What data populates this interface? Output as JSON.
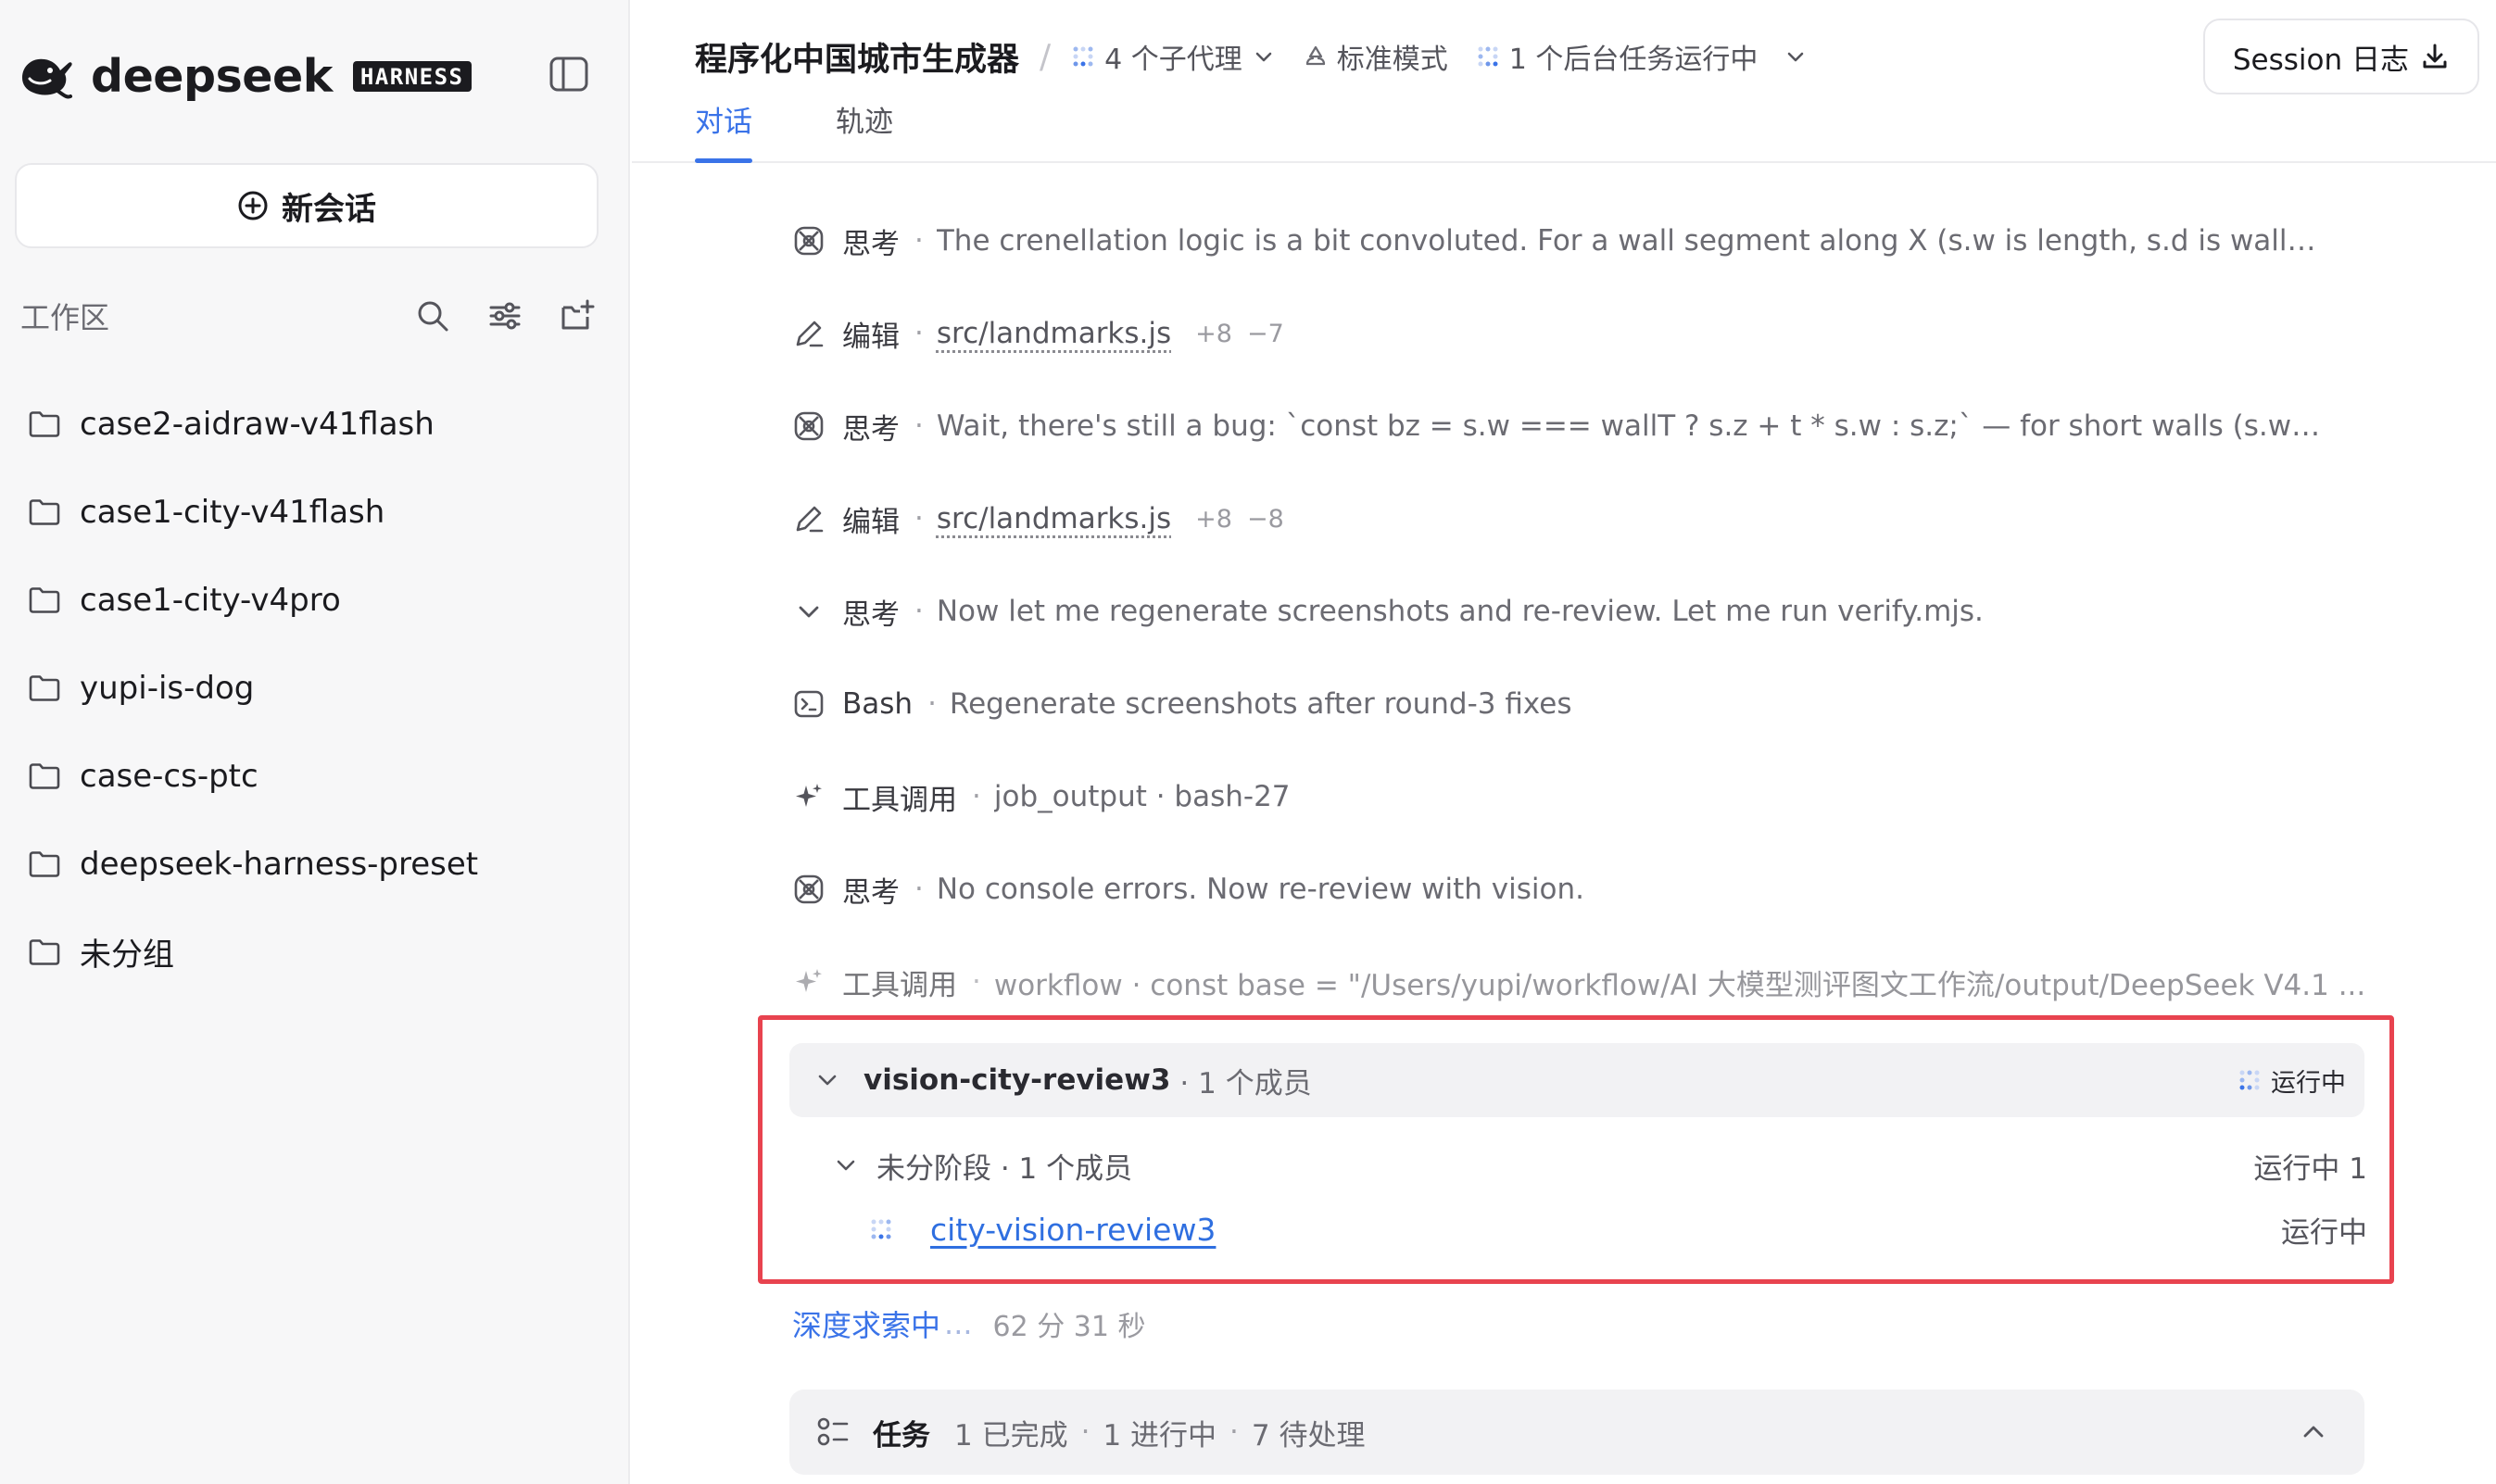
{
  "sidebar": {
    "brand_name": "deepseek",
    "brand_badge": "HARNESS",
    "new_chat_label": "新会话",
    "workspace_label": "工作区",
    "folders": [
      {
        "label": "case2-aidraw-v41flash"
      },
      {
        "label": "case1-city-v41flash"
      },
      {
        "label": "case1-city-v4pro"
      },
      {
        "label": "yupi-is-dog"
      },
      {
        "label": "case-cs-ptc"
      },
      {
        "label": "deepseek-harness-preset"
      },
      {
        "label": "未分组"
      }
    ]
  },
  "header": {
    "title": "程序化中国城市生成器",
    "separator": "/",
    "subagents": "4 个子代理",
    "mode": "标准模式",
    "background_tasks": "1 个后台任务运行中",
    "session_log_label": "Session 日志",
    "tabs": [
      {
        "label": "对话",
        "active": true
      },
      {
        "label": "轨迹",
        "active": false
      }
    ]
  },
  "feed": [
    {
      "icon": "thinking-icon",
      "kind": "思考",
      "desc": "The crenellation logic is a bit convoluted. For a wall segment along X (s.w is length, s.d is wallT), the..."
    },
    {
      "icon": "edit-icon",
      "kind": "编辑",
      "file": "src/landmarks.js",
      "added": "+8",
      "removed": "−7"
    },
    {
      "icon": "thinking-icon",
      "kind": "思考",
      "desc": "Wait, there's still a bug: `const bz = s.w === wallT ? s.z + t * s.w : s.z;` — for short walls (s.w === w..."
    },
    {
      "icon": "edit-icon",
      "kind": "编辑",
      "file": "src/landmarks.js",
      "added": "+8",
      "removed": "−8"
    },
    {
      "icon": "chevron-down-icon",
      "kind": "思考",
      "desc": "Now let me regenerate screenshots and re-review. Let me run verify.mjs."
    },
    {
      "icon": "terminal-icon",
      "kind": "Bash",
      "desc": "Regenerate screenshots after round-3 fixes"
    },
    {
      "icon": "sparkle-icon",
      "kind": "工具调用",
      "desc": "job_output · bash-27"
    },
    {
      "icon": "thinking-icon",
      "kind": "思考",
      "desc": "No console errors. Now re-review with vision."
    },
    {
      "icon": "sparkle-icon",
      "kind": "工具调用",
      "desc": "workflow · const base = \"/Users/yupi/workflow/AI 大模型测评图文工作流/output/DeepSeek V4.1 ..."
    }
  ],
  "group": {
    "name": "vision-city-review3",
    "count": "· 1 个成员",
    "status": "运行中",
    "phase": {
      "label": "未分阶段 · 1 个成员",
      "status": "运行中 1"
    },
    "member": {
      "name": "city-vision-review3",
      "status": "运行中"
    }
  },
  "deep_search": {
    "label": "深度求索中",
    "ellipsis": "...",
    "elapsed": "62 分 31 秒"
  },
  "tasks": {
    "title": "任务",
    "done": "1 已完成",
    "in_progress": "1 进行中",
    "pending": "7 待处理"
  },
  "colors": {
    "accent": "#3a73e8",
    "highlight_border": "#e8434f",
    "sidebar_bg": "#f7f7f8"
  }
}
